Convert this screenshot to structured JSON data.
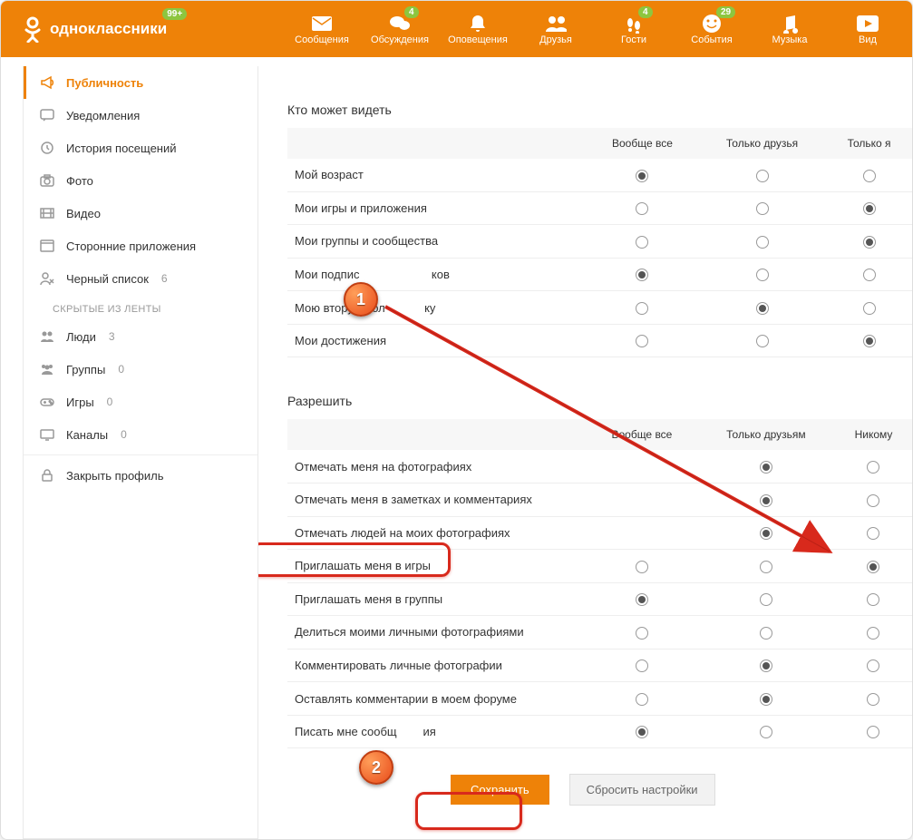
{
  "header": {
    "brand": "одноклассники",
    "brand_badge": "99+",
    "nav": {
      "messages": "Сообщения",
      "discussions": "Обсуждения",
      "discussions_badge": "4",
      "notifications": "Оповещения",
      "friends": "Друзья",
      "guests": "Гости",
      "guests_badge": "4",
      "events": "События",
      "events_badge": "29",
      "music": "Музыка",
      "video": "Вид"
    }
  },
  "sidebar": {
    "items": {
      "publicity": "Публичность",
      "notifications": "Уведомления",
      "history": "История посещений",
      "photo": "Фото",
      "video": "Видео",
      "apps": "Сторонние приложения",
      "blacklist": "Черный список",
      "blacklist_count": "6"
    },
    "hidden_heading": "СКРЫТЫЕ ИЗ ЛЕНТЫ",
    "hidden": {
      "people": "Люди",
      "people_count": "3",
      "groups": "Группы",
      "groups_count": "0",
      "games": "Игры",
      "games_count": "0",
      "channels": "Каналы",
      "channels_count": "0"
    },
    "close_profile": "Закрыть профиль"
  },
  "main": {
    "section1_title": "Кто может видеть",
    "cols1": {
      "all": "Вообще все",
      "friends": "Только друзья",
      "me": "Только я"
    },
    "rows1": {
      "age": "Мой возраст",
      "games": "Мои игры и приложения",
      "groups": "Мои группы и сообщества",
      "subs": "Мои подпис                      ков",
      "spouse": "Мою вторую пол            ку",
      "achievements": "Мои достижения"
    },
    "section2_title": "Разрешить",
    "cols2": {
      "all": "Вообще все",
      "friends": "Только друзьям",
      "none": "Никому"
    },
    "rows2": {
      "tag_photos": "Отмечать меня на фотографиях",
      "tag_notes": "Отмечать меня в заметках и комментариях",
      "tag_my_photos": "Отмечать людей на моих фотографиях",
      "invite_games": "Приглашать меня в игры",
      "invite_groups": "Приглашать меня в группы",
      "share_photos": "Делиться моими личными фотографиями",
      "comment_photos": "Комментировать личные фотографии",
      "forum_comments": "Оставлять комментарии в моем форуме",
      "messages": "Писать мне сообщ        ия"
    },
    "save": "Сохранить",
    "reset": "Сбросить настройки"
  },
  "annotations": {
    "step1": "1",
    "step2": "2"
  },
  "privacy_selection": {
    "see": {
      "age": 0,
      "games": 2,
      "groups": 2,
      "subs": 0,
      "spouse": 1,
      "achievements": 2
    },
    "allow": {
      "tag_photos": 1,
      "tag_notes": 1,
      "tag_my_photos": 1,
      "invite_games": 2,
      "invite_groups": 0,
      "share_photos": null,
      "comment_photos": 1,
      "forum_comments": 1,
      "messages": 0
    }
  }
}
